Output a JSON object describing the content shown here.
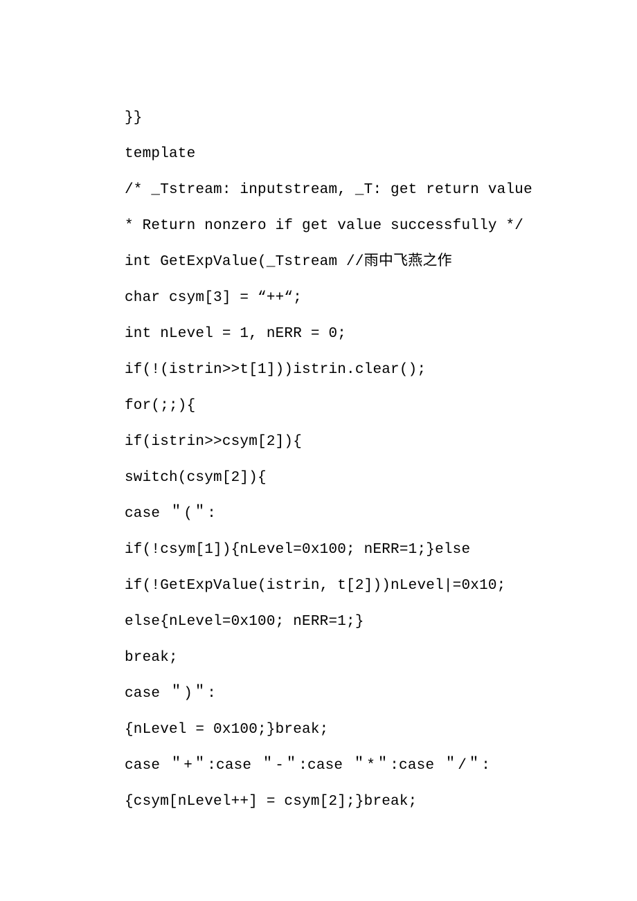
{
  "lines": [
    "}}",
    "template",
    "/* _Tstream: inputstream, _T: get return value",
    "* Return nonzero if get value successfully */",
    "int GetExpValue(_Tstream //雨中飞燕之作",
    "char csym[3] = “++“;",
    "int nLevel = 1, nERR = 0;",
    "if(!(istrin>>t[1]))istrin.clear();",
    "for(;;){",
    "if(istrin>>csym[2]){",
    "switch(csym[2]){",
    "case ＂(＂:",
    "if(!csym[1]){nLevel=0x100; nERR=1;}else",
    "if(!GetExpValue(istrin, t[2]))nLevel|=0x10;",
    "else{nLevel=0x100; nERR=1;}",
    "break;",
    "case ＂)＂:",
    "{nLevel = 0x100;}break;",
    "case ＂+＂:case ＂-＂:case ＂*＂:case ＂/＂:",
    "{csym[nLevel++] = csym[2];}break;"
  ]
}
